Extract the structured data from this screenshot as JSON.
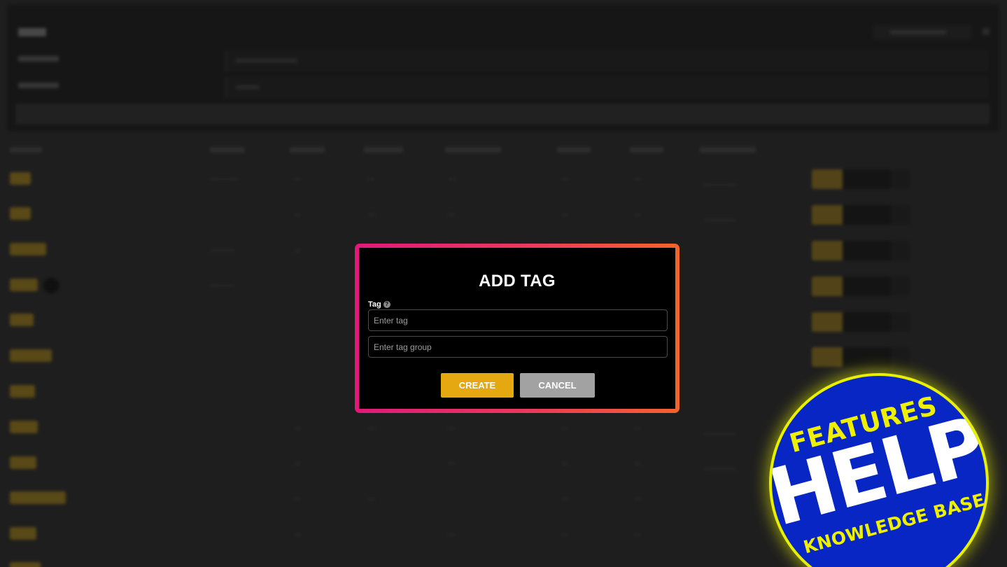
{
  "modal": {
    "title": "ADD TAG",
    "tag_label": "Tag",
    "tag_placeholder": "Enter tag",
    "tag_group_placeholder": "Enter tag group",
    "create_label": "CREATE",
    "cancel_label": "CANCEL",
    "border_gradient": [
      "#e2187a",
      "#f2642a"
    ]
  },
  "badge": {
    "line1": "FEATURES",
    "line2": "HELP",
    "line3": "KNOWLEDGE BASE",
    "background": "#0726c4",
    "accent": "#eef000"
  },
  "colors": {
    "create_button": "#e6a810",
    "cancel_button": "#a2a2a2"
  }
}
